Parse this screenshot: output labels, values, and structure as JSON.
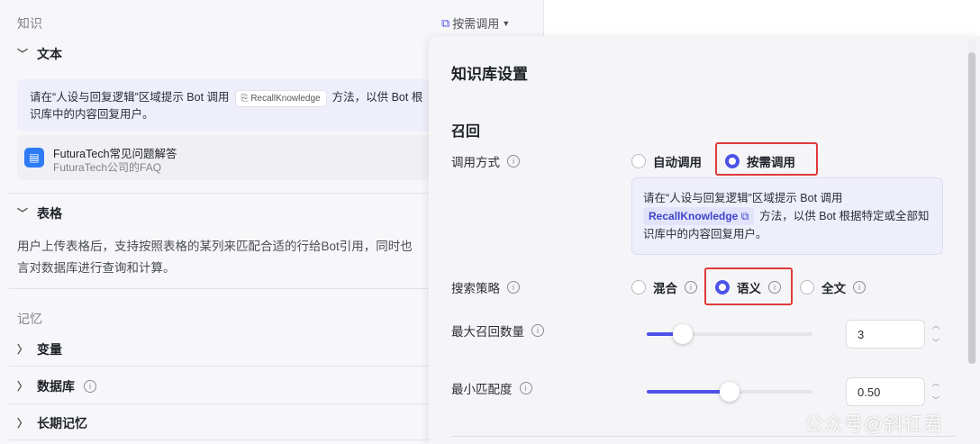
{
  "left": {
    "knowledge_label": "知识",
    "trigger_label": "按需调用",
    "text_section": "文本",
    "hint_text_before": "请在“人设与回复逻辑”区域提示 Bot 调用",
    "hint_chip": "RecallKnowledge",
    "hint_text_after": "方法，以供 Bot 根",
    "hint_line2": "识库中的内容回复用户。",
    "kb_name": "FuturaTech常见问题解答",
    "kb_desc": "FuturaTech公司的FAQ",
    "table_section": "表格",
    "table_desc_line1": "用户上传表格后，支持按照表格的某列来匹配合适的行给Bot引用，同时也",
    "table_desc_line2": "言对数据库进行查询和计算。",
    "memory_label": "记忆",
    "variables": "变量",
    "database": "数据库",
    "long_memory": "长期记忆"
  },
  "modal": {
    "title": "知识库设置",
    "section": "召回",
    "call_mode_label": "调用方式",
    "call_modes": [
      "自动调用",
      "按需调用"
    ],
    "call_mode_selected": "按需调用",
    "method_text_before": "请在“人设与回复逻辑”区域提示 Bot 调用",
    "method_chip": "RecallKnowledge",
    "method_text_after": "方法，以供 Bot 根据特定或全部知识库中的内容回复用户。",
    "search_label": "搜索策略",
    "search_modes": [
      "混合",
      "语义",
      "全文"
    ],
    "search_selected": "语义",
    "max_recall_label": "最大召回数量",
    "max_recall_value": "3",
    "max_recall_fraction": 0.22,
    "min_match_label": "最小匹配度",
    "min_match_value": "0.50",
    "min_match_fraction": 0.5
  },
  "watermark": "公众号@斜杠君",
  "colors": {
    "accent": "#4d53e8",
    "highlight": "#e03a3a",
    "kb_icon": "#2e7bf6"
  }
}
